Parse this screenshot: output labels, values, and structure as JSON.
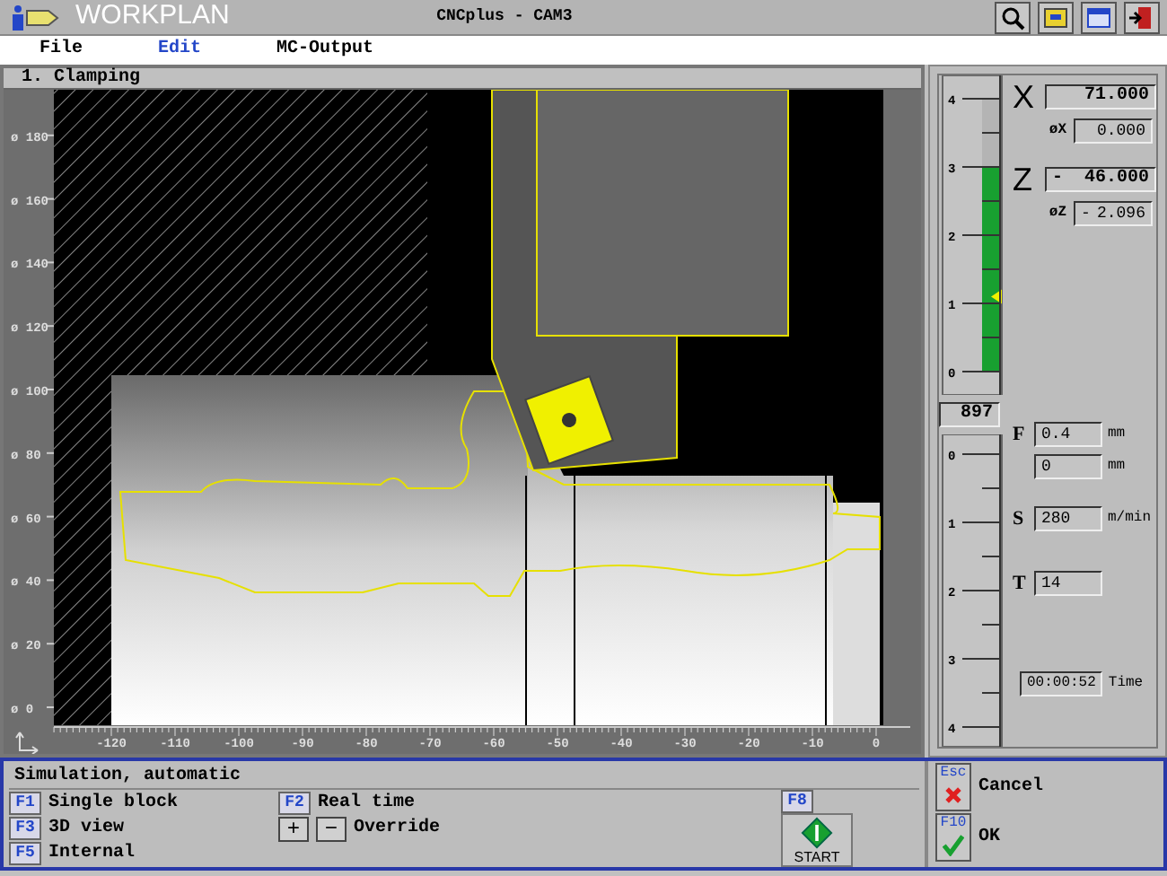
{
  "title_bar": {
    "app": "WORKPLAN",
    "title": "CNCplus - CAM3"
  },
  "menu": [
    {
      "label": "File",
      "selected": false
    },
    {
      "label": "Edit",
      "selected": true
    },
    {
      "label": "MC-Output",
      "selected": false
    }
  ],
  "view": {
    "title": "1. Clamping",
    "y_ticks": [
      "ø 180",
      "ø 160",
      "ø 140",
      "ø 120",
      "ø 100",
      "ø 80",
      "ø 60",
      "ø 40",
      "ø 20",
      "ø 0"
    ],
    "x_ticks": [
      "-120",
      "-110",
      "-100",
      "-90",
      "-80",
      "-70",
      "-60",
      "-50",
      "-40",
      "-30",
      "-20",
      "-10",
      "0"
    ]
  },
  "spindle": {
    "upper_scale": [
      "4",
      "3",
      "2",
      "1",
      "0"
    ],
    "level": 0.75,
    "speed": "897",
    "lower_scale": [
      "0",
      "1",
      "2",
      "3",
      "4"
    ]
  },
  "axes": [
    {
      "axis": "X",
      "value": "71.000",
      "delta_label": "øX",
      "delta": "0.000"
    },
    {
      "axis": "Z",
      "sign": "-",
      "value": "46.000",
      "delta_label": "øZ",
      "delta_sign": "-",
      "delta": "2.096"
    }
  ],
  "feeds": [
    {
      "letter": "F",
      "value": "0.4",
      "unit": "mm"
    },
    {
      "value": "0",
      "unit": "mm"
    },
    {
      "letter": "S",
      "value": "280",
      "unit": "m/min"
    },
    {
      "letter": "T",
      "value": "14"
    }
  ],
  "time": {
    "value": "00:00:52",
    "label": "Time"
  },
  "simulation": {
    "title": "Simulation, automatic",
    "options": [
      {
        "key": "F1",
        "label": "Single block"
      },
      {
        "key": "F3",
        "label": "3D view"
      },
      {
        "key": "F5",
        "label": "Internal"
      }
    ],
    "real_time": {
      "key": "F2",
      "label": "Real time"
    },
    "override": {
      "plus": "+",
      "minus": "−",
      "label": "Override"
    },
    "start": {
      "key": "F8",
      "label": "START"
    }
  },
  "actions": [
    {
      "key": "Esc",
      "label": "Cancel",
      "kind": "cancel"
    },
    {
      "key": "F10",
      "label": "OK",
      "kind": "ok"
    }
  ]
}
